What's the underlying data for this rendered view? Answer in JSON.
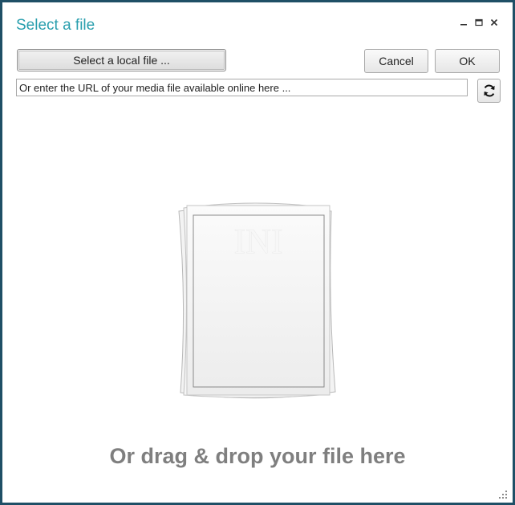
{
  "window": {
    "title": "Select a file",
    "controls": {
      "minimize": "minimize-icon",
      "maximize": "maximize-icon",
      "close": "close-icon"
    }
  },
  "toolbar": {
    "select_local_label": "Select a local file ...",
    "cancel_label": "Cancel",
    "ok_label": "OK"
  },
  "url": {
    "value": "",
    "placeholder": "Or enter the URL of your media file available online here ..."
  },
  "refresh": {
    "icon": "refresh-icon"
  },
  "dropzone": {
    "icon": "document-stack-icon",
    "text": "Or drag & drop your file here"
  },
  "colors": {
    "title": "#2a9fae",
    "window_border": "#1f4f66",
    "drop_text": "#7f7f7f"
  }
}
